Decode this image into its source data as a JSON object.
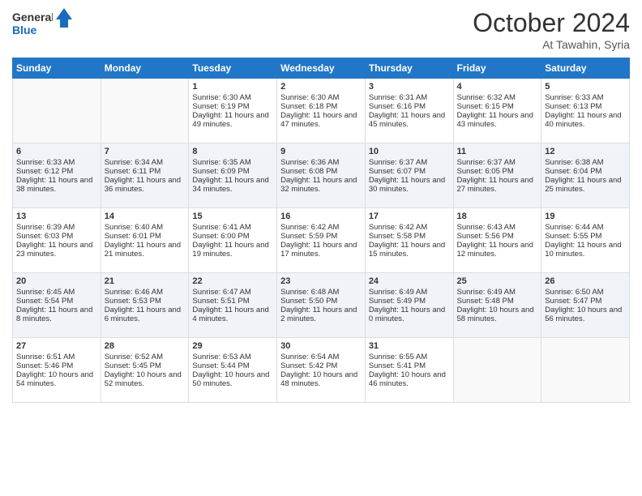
{
  "header": {
    "logo_line1": "General",
    "logo_line2": "Blue",
    "month": "October 2024",
    "location": "At Tawahin, Syria"
  },
  "days_of_week": [
    "Sunday",
    "Monday",
    "Tuesday",
    "Wednesday",
    "Thursday",
    "Friday",
    "Saturday"
  ],
  "weeks": [
    [
      {
        "day": null,
        "text": null
      },
      {
        "day": null,
        "text": null
      },
      {
        "day": "1",
        "text": "Sunrise: 6:30 AM\nSunset: 6:19 PM\nDaylight: 11 hours and 49 minutes."
      },
      {
        "day": "2",
        "text": "Sunrise: 6:30 AM\nSunset: 6:18 PM\nDaylight: 11 hours and 47 minutes."
      },
      {
        "day": "3",
        "text": "Sunrise: 6:31 AM\nSunset: 6:16 PM\nDaylight: 11 hours and 45 minutes."
      },
      {
        "day": "4",
        "text": "Sunrise: 6:32 AM\nSunset: 6:15 PM\nDaylight: 11 hours and 43 minutes."
      },
      {
        "day": "5",
        "text": "Sunrise: 6:33 AM\nSunset: 6:13 PM\nDaylight: 11 hours and 40 minutes."
      }
    ],
    [
      {
        "day": "6",
        "text": "Sunrise: 6:33 AM\nSunset: 6:12 PM\nDaylight: 11 hours and 38 minutes."
      },
      {
        "day": "7",
        "text": "Sunrise: 6:34 AM\nSunset: 6:11 PM\nDaylight: 11 hours and 36 minutes."
      },
      {
        "day": "8",
        "text": "Sunrise: 6:35 AM\nSunset: 6:09 PM\nDaylight: 11 hours and 34 minutes."
      },
      {
        "day": "9",
        "text": "Sunrise: 6:36 AM\nSunset: 6:08 PM\nDaylight: 11 hours and 32 minutes."
      },
      {
        "day": "10",
        "text": "Sunrise: 6:37 AM\nSunset: 6:07 PM\nDaylight: 11 hours and 30 minutes."
      },
      {
        "day": "11",
        "text": "Sunrise: 6:37 AM\nSunset: 6:05 PM\nDaylight: 11 hours and 27 minutes."
      },
      {
        "day": "12",
        "text": "Sunrise: 6:38 AM\nSunset: 6:04 PM\nDaylight: 11 hours and 25 minutes."
      }
    ],
    [
      {
        "day": "13",
        "text": "Sunrise: 6:39 AM\nSunset: 6:03 PM\nDaylight: 11 hours and 23 minutes."
      },
      {
        "day": "14",
        "text": "Sunrise: 6:40 AM\nSunset: 6:01 PM\nDaylight: 11 hours and 21 minutes."
      },
      {
        "day": "15",
        "text": "Sunrise: 6:41 AM\nSunset: 6:00 PM\nDaylight: 11 hours and 19 minutes."
      },
      {
        "day": "16",
        "text": "Sunrise: 6:42 AM\nSunset: 5:59 PM\nDaylight: 11 hours and 17 minutes."
      },
      {
        "day": "17",
        "text": "Sunrise: 6:42 AM\nSunset: 5:58 PM\nDaylight: 11 hours and 15 minutes."
      },
      {
        "day": "18",
        "text": "Sunrise: 6:43 AM\nSunset: 5:56 PM\nDaylight: 11 hours and 12 minutes."
      },
      {
        "day": "19",
        "text": "Sunrise: 6:44 AM\nSunset: 5:55 PM\nDaylight: 11 hours and 10 minutes."
      }
    ],
    [
      {
        "day": "20",
        "text": "Sunrise: 6:45 AM\nSunset: 5:54 PM\nDaylight: 11 hours and 8 minutes."
      },
      {
        "day": "21",
        "text": "Sunrise: 6:46 AM\nSunset: 5:53 PM\nDaylight: 11 hours and 6 minutes."
      },
      {
        "day": "22",
        "text": "Sunrise: 6:47 AM\nSunset: 5:51 PM\nDaylight: 11 hours and 4 minutes."
      },
      {
        "day": "23",
        "text": "Sunrise: 6:48 AM\nSunset: 5:50 PM\nDaylight: 11 hours and 2 minutes."
      },
      {
        "day": "24",
        "text": "Sunrise: 6:49 AM\nSunset: 5:49 PM\nDaylight: 11 hours and 0 minutes."
      },
      {
        "day": "25",
        "text": "Sunrise: 6:49 AM\nSunset: 5:48 PM\nDaylight: 10 hours and 58 minutes."
      },
      {
        "day": "26",
        "text": "Sunrise: 6:50 AM\nSunset: 5:47 PM\nDaylight: 10 hours and 56 minutes."
      }
    ],
    [
      {
        "day": "27",
        "text": "Sunrise: 6:51 AM\nSunset: 5:46 PM\nDaylight: 10 hours and 54 minutes."
      },
      {
        "day": "28",
        "text": "Sunrise: 6:52 AM\nSunset: 5:45 PM\nDaylight: 10 hours and 52 minutes."
      },
      {
        "day": "29",
        "text": "Sunrise: 6:53 AM\nSunset: 5:44 PM\nDaylight: 10 hours and 50 minutes."
      },
      {
        "day": "30",
        "text": "Sunrise: 6:54 AM\nSunset: 5:42 PM\nDaylight: 10 hours and 48 minutes."
      },
      {
        "day": "31",
        "text": "Sunrise: 6:55 AM\nSunset: 5:41 PM\nDaylight: 10 hours and 46 minutes."
      },
      {
        "day": null,
        "text": null
      },
      {
        "day": null,
        "text": null
      }
    ]
  ]
}
